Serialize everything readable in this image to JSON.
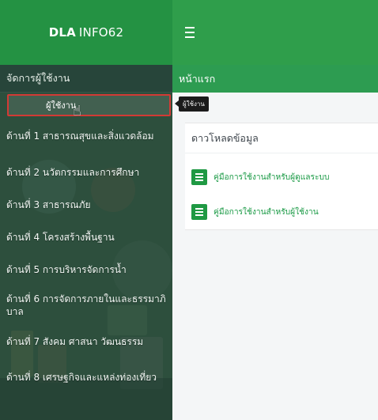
{
  "brand": {
    "bold": "DLA",
    "rest": "INFO62"
  },
  "header": {
    "menu_toggle_icon": "hamburger-icon"
  },
  "sidebar": {
    "section_title": "จัดการผู้ใช้งาน",
    "subitems": [
      {
        "label": "ผู้ใช้งาน",
        "active": true
      }
    ],
    "items": [
      {
        "label": "ด้านที่ 1 สาธารณสุขและสิ่งแวดล้อม"
      },
      {
        "label": "ด้านที่ 2 นวัตกรรมและการศึกษา"
      },
      {
        "label": "ด้านที่ 3 สาธารณภัย"
      },
      {
        "label": "ด้านที่ 4 โครงสร้างพื้นฐาน"
      },
      {
        "label": "ด้านที่ 5 การบริหารจัดการน้ำ"
      },
      {
        "label": "ด้านที่ 6 การจัดการภายในและธรรมาภิบาล"
      },
      {
        "label": "ด้านที่ 7 สังคม ศาสนา วัฒนธรรม"
      },
      {
        "label": "ด้านที่ 8 เศรษฐกิจและแหล่งท่องเที่ยว"
      }
    ]
  },
  "tooltip": {
    "text": "ผู้ใช้งาน"
  },
  "main": {
    "page_title": "หน้าแรก",
    "panel_title": "ดาวโหลดข้อมูล",
    "downloads": [
      {
        "label": "คู่มือการใช้งานสำหรับผู้ดูแลระบบ",
        "icon": "document-icon"
      },
      {
        "label": "คู่มือการใช้งานสำหรับผู้ใช้งาน",
        "icon": "document-icon"
      }
    ]
  },
  "colors": {
    "topbar": "#2f9e4b",
    "brand": "#249243",
    "sidebar": "#2d4f3d",
    "active_border": "#d33a35",
    "link": "#1a9a45"
  }
}
